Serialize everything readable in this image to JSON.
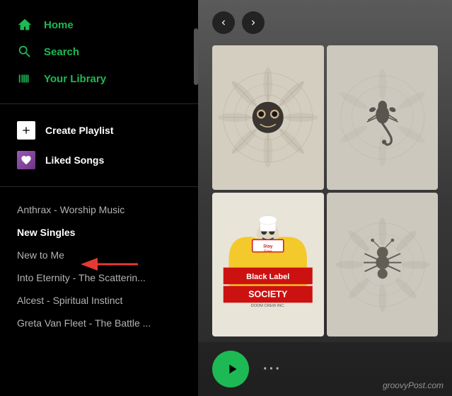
{
  "sidebar": {
    "nav": [
      {
        "id": "home",
        "label": "Home",
        "icon": "home"
      },
      {
        "id": "search",
        "label": "Search",
        "icon": "search"
      },
      {
        "id": "library",
        "label": "Your Library",
        "icon": "library"
      }
    ],
    "actions": [
      {
        "id": "create-playlist",
        "label": "Create Playlist",
        "icon": "plus",
        "bg": "white"
      },
      {
        "id": "liked-songs",
        "label": "Liked Songs",
        "icon": "heart",
        "bg": "purple"
      }
    ],
    "playlists": [
      {
        "id": "anthrax",
        "label": "Anthrax - Worship Music",
        "active": false
      },
      {
        "id": "new-singles",
        "label": "New Singles",
        "active": true
      },
      {
        "id": "new-to-me",
        "label": "New to Me",
        "active": false
      },
      {
        "id": "into-eternity",
        "label": "Into Eternity - The Scatterin...",
        "active": false
      },
      {
        "id": "alcest",
        "label": "Alcest - Spiritual Instinct",
        "active": false
      },
      {
        "id": "greta",
        "label": "Greta Van Fleet - The Battle ...",
        "active": false
      }
    ]
  },
  "nav_controls": {
    "back": "‹",
    "forward": "›"
  },
  "player": {
    "play_label": "▶",
    "more_label": "···"
  },
  "watermark": "groovyPost.com"
}
